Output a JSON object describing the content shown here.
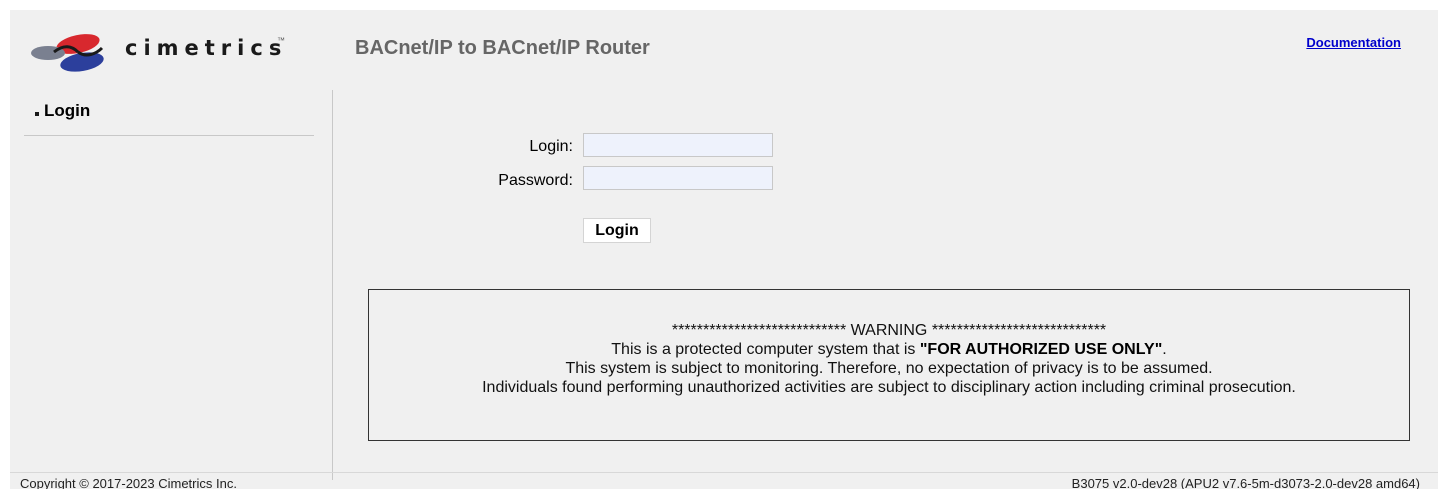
{
  "header": {
    "logo_text": "cimetrics",
    "logo_tm": "™",
    "title": "BACnet/IP to BACnet/IP Router",
    "documentation_link": "Documentation"
  },
  "sidebar": {
    "items": [
      {
        "label": "Login"
      }
    ]
  },
  "login_form": {
    "login_label": "Login:",
    "login_value": "",
    "password_label": "Password:",
    "password_value": "",
    "submit_label": "Login"
  },
  "warning": {
    "line1": "**************************** WARNING ****************************",
    "line2_prefix": "This is a protected computer system that is ",
    "line2_emphasis": "\"FOR AUTHORIZED USE ONLY\"",
    "line2_suffix": ".",
    "line3": "This system is subject to monitoring. Therefore, no expectation of privacy is to be assumed.",
    "line4": "Individuals found performing unauthorized activities are subject to disciplinary action including criminal prosecution."
  },
  "footer": {
    "copyright": "Copyright © 2017-2023 Cimetrics Inc.",
    "version": "B3075 v2.0-dev28 (APU2 v7.6-5m-d3073-2.0-dev28 amd64)"
  },
  "colors": {
    "background": "#f0f0f0",
    "link": "#0000cc",
    "title": "#666666",
    "logo_red": "#d8282e",
    "logo_blue": "#2c3f9c",
    "logo_gray": "#7a8090"
  }
}
